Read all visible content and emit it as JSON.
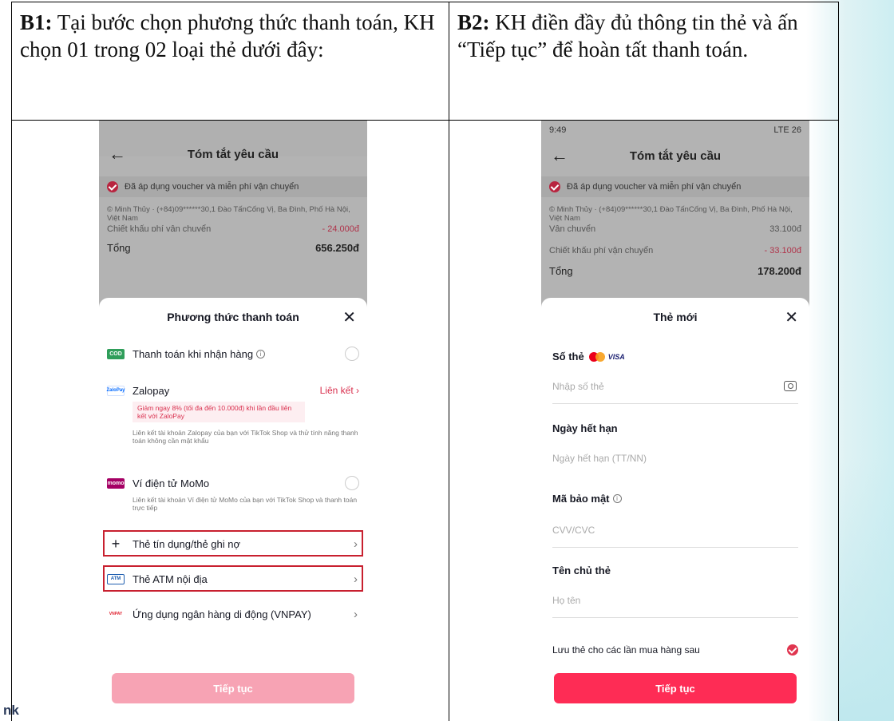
{
  "header": {
    "b1_label": "B1:",
    "b1_text": " Tại bước chọn phương thức thanh toán, KH chọn 01 trong 02 loại thẻ dưới đây:",
    "b2_label": "B2:",
    "b2_text": " KH điền đầy đủ thông tin thẻ và ấn “Tiếp tục” để hoàn tất thanh toán."
  },
  "watermark": "nk",
  "phone1": {
    "nav_title": "Tóm tắt yêu cầu",
    "voucher": "Đã áp dụng voucher và miễn phí vận chuyển",
    "address": "© Minh Thủy · (+84)09******30,1 Đào TấnCống Vị, Ba Đình, Phố Hà Nội, Việt Nam",
    "partial_row_label": "Chiết khấu phí vận chuyển",
    "partial_row_value": "- 24.000đ",
    "total_label": "Tổng",
    "total_value": "656.250đ",
    "sheet_title": "Phương thức thanh toán",
    "options": {
      "cod_icon": "COD",
      "cod_label": "Thanh toán khi nhận hàng",
      "zalo_icon": "ZaloPay",
      "zalo_label": "Zalopay",
      "zalo_link": "Liên kết",
      "zalo_promo": "Giảm ngay 8% (tối đa đến 10.000đ) khi lần đầu liên kết với ZaloPay",
      "zalo_desc": "Liên kết tài khoản Zalopay của bạn với TikTok Shop và thử tính năng thanh toán không cần mật khẩu",
      "momo_icon": "momo",
      "momo_label": "Ví điện tử MoMo",
      "momo_desc": "Liên kết tài khoản Ví điện tử MoMo của bạn với TikTok Shop và thanh toán trực tiếp",
      "credit_label": "Thẻ tín dụng/thẻ ghi nợ",
      "atm_icon": "ATM",
      "atm_label": "Thẻ ATM nội địa",
      "vnpay_icon": "VNPAY",
      "vnpay_label": "Ứng dụng ngân hàng di động (VNPAY)"
    },
    "cta": "Tiếp tục"
  },
  "phone2": {
    "status_time": "9:49",
    "status_right": "LTE 26",
    "nav_title": "Tóm tắt yêu cầu",
    "voucher": "Đã áp dụng voucher và miễn phí vận chuyển",
    "address": "© Minh Thủy · (+84)09******30,1 Đào TấnCống Vị, Ba Đình, Phố Hà Nội, Việt Nam",
    "partial_row_label": "Vận chuyển",
    "partial_row_value": "33.100đ",
    "discount_label": "Chiết khấu phí vận chuyển",
    "discount_value": "- 33.100đ",
    "total_label": "Tổng",
    "total_value": "178.200đ",
    "sheet_title": "Thẻ mới",
    "card_number_label": "Số thẻ",
    "visa": "VISA",
    "card_number_placeholder": "Nhập số thẻ",
    "expiry_label": "Ngày hết hạn",
    "expiry_placeholder": "Ngày hết hạn (TT/NN)",
    "cvv_label": "Mã bảo mật",
    "cvv_placeholder": "CVV/CVC",
    "holder_label": "Tên chủ thẻ",
    "holder_placeholder": "Họ tên",
    "save_label": "Lưu thẻ cho các lần mua hàng sau",
    "cta": "Tiếp tục"
  },
  "colors": {
    "accent": "#fe2c55",
    "highlight_border": "#c8202f",
    "cta_disabled": "#f7a3b4"
  }
}
